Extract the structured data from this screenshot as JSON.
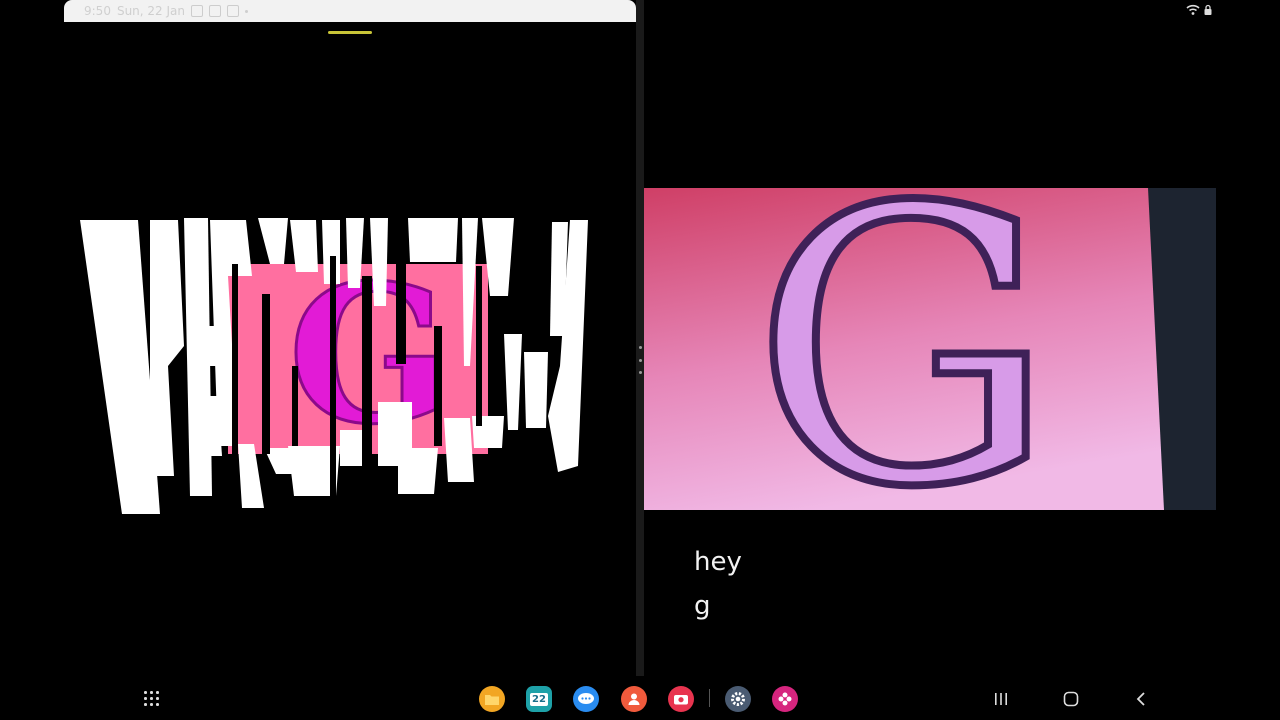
{
  "status_bar": {
    "time": "9:50",
    "date": "Sun, 22 Jan"
  },
  "right_pane": {
    "caption_line1": "hey",
    "caption_line2": "g"
  },
  "photo": {
    "letter": "G",
    "colors": {
      "background": "#e05a86",
      "letter_fill": "#d79be8",
      "letter_outline": "#4a2a64"
    }
  },
  "glitch": {
    "letter": "G",
    "colors": {
      "panel": "#ff6fa0",
      "letter": "#e21bd6"
    }
  },
  "taskbar": {
    "calendar_day": "22",
    "apps": [
      "my-files-icon",
      "calendar-icon",
      "messages-icon",
      "contacts-icon",
      "camera-icon",
      "settings-icon",
      "gallery-icon"
    ]
  }
}
